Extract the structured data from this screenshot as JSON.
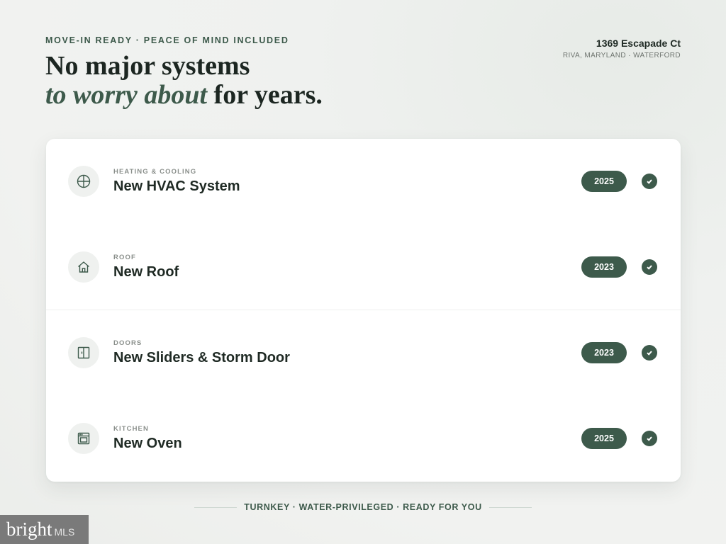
{
  "header": {
    "eyebrow": "MOVE-IN READY · PEACE OF MIND INCLUDED",
    "headline_line1": "No major systems",
    "headline_accent": "to worry about",
    "headline_rest": " for years.",
    "accent_color": "#3d5a4b"
  },
  "address": {
    "street": "1369 Escapade Ct",
    "locale": "RIVA, MARYLAND · WATERFORD"
  },
  "items": [
    {
      "category": "HEATING & COOLING",
      "title": "New HVAC System",
      "year": "2025",
      "icon": "hvac-fan-icon"
    },
    {
      "category": "ROOF",
      "title": "New Roof",
      "year": "2023",
      "icon": "house-icon"
    },
    {
      "category": "DOORS",
      "title": "New Sliders & Storm Door",
      "year": "2023",
      "icon": "door-icon"
    },
    {
      "category": "KITCHEN",
      "title": "New Oven",
      "year": "2025",
      "icon": "oven-icon"
    }
  ],
  "footer": {
    "tagline": "TURNKEY · WATER-PRIVILEGED · READY FOR YOU"
  },
  "watermark": {
    "brand": "bright",
    "suffix": "MLS"
  }
}
